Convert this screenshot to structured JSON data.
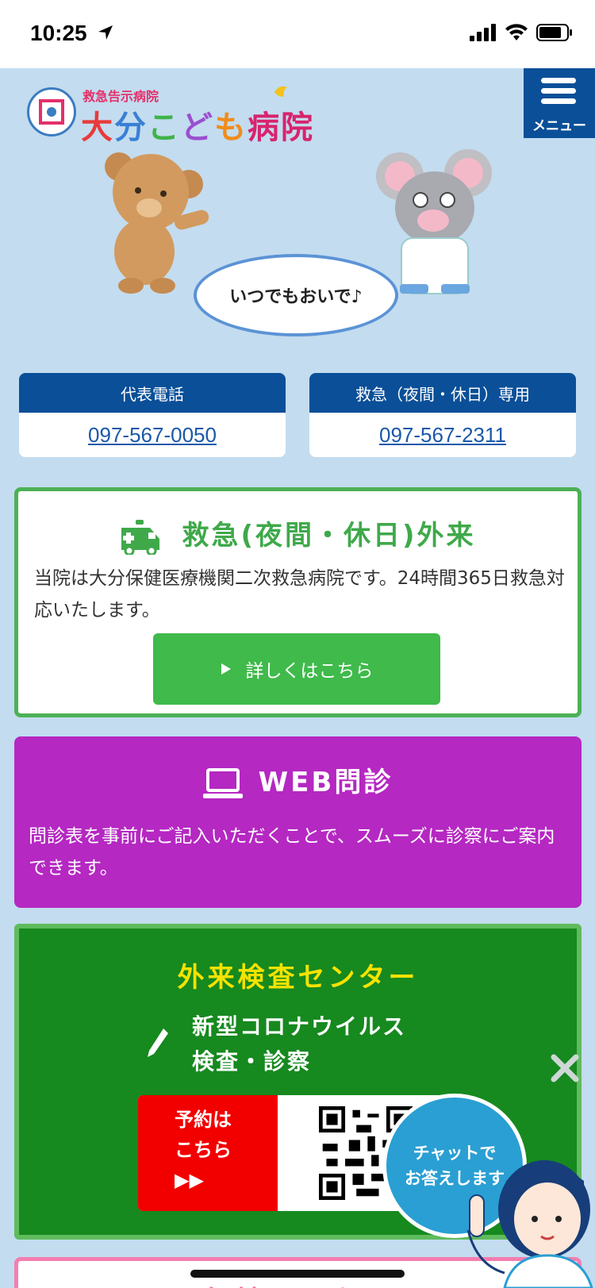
{
  "status_bar": {
    "time": "10:25"
  },
  "header": {
    "logo_sub": "救急告示病院",
    "logo_main": [
      "大",
      "分",
      "こ",
      "ど",
      "も",
      "病",
      "院"
    ],
    "logo_colors": [
      "#e83a3a",
      "#3a7fd6",
      "#3fb34a",
      "#9b4fd1",
      "#f08c1a",
      "#d8236e",
      "#d8236e"
    ],
    "menu_label": "メニュー"
  },
  "hero": {
    "bubble_text": "いつでもおいで♪"
  },
  "phones": [
    {
      "label": "代表電話",
      "number": "097-567-0050"
    },
    {
      "label": "救急（夜間・休日）専用",
      "number": "097-567-2311"
    }
  ],
  "emergency": {
    "title": "救急(夜間・休日)外来",
    "text": "当院は大分保健医療機関二次救急病院です。24時間365日救急対応いたします。",
    "button": "詳しくはこちら"
  },
  "web": {
    "title": "WEB問診",
    "text": "問診表を事前にご記入いただくことで、スムーズに診察にご案内できます。"
  },
  "test_center": {
    "title": "外来検査センター",
    "sub_line1": "新型コロナウイルス",
    "sub_line2": "検査・診察",
    "reserve_line1": "予約は",
    "reserve_line2": "こちら",
    "reserve_line3": "▶▶"
  },
  "health_center": {
    "title": "保健センター"
  },
  "chat": {
    "line1": "チャットで",
    "line2": "お答えします"
  },
  "colors": {
    "navy": "#0a4f98",
    "green": "#3fba4b",
    "purple": "#b528c2",
    "dark_green": "#16891f",
    "pink": "#f27fb0",
    "bg": "#c3dcef"
  }
}
